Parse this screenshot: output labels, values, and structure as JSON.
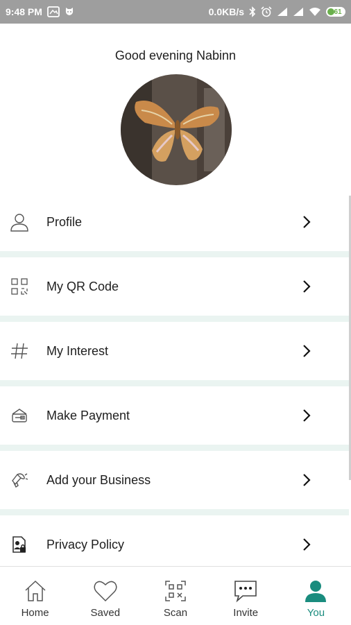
{
  "status_bar": {
    "time": "9:48 PM",
    "network_speed": "0.0KB/s",
    "battery": "61",
    "icons": [
      "image-icon",
      "cat-icon",
      "bluetooth-icon",
      "alarm-icon",
      "signal-icon",
      "signal-icon",
      "wifi-icon",
      "battery-icon"
    ]
  },
  "greeting": "Good evening Nabinn",
  "menu": {
    "items": [
      {
        "label": "Profile",
        "icon": "user-icon"
      },
      {
        "label": "My QR Code",
        "icon": "qr-code-icon"
      },
      {
        "label": "My Interest",
        "icon": "hashtag-icon"
      },
      {
        "label": "Make Payment",
        "icon": "wallet-icon"
      },
      {
        "label": "Add your Business",
        "icon": "megaphone-icon"
      },
      {
        "label": "Privacy Policy",
        "icon": "privacy-icon"
      }
    ]
  },
  "bottom_nav": {
    "items": [
      {
        "label": "Home",
        "icon": "home-icon",
        "active": false
      },
      {
        "label": "Saved",
        "icon": "heart-icon",
        "active": false
      },
      {
        "label": "Scan",
        "icon": "scan-icon",
        "active": false
      },
      {
        "label": "Invite",
        "icon": "chat-icon",
        "active": false
      },
      {
        "label": "You",
        "icon": "user-icon",
        "active": true
      }
    ]
  },
  "colors": {
    "accent": "#1a8c7e",
    "separator": "#eaf4f1",
    "status_bar": "#9e9e9e"
  }
}
